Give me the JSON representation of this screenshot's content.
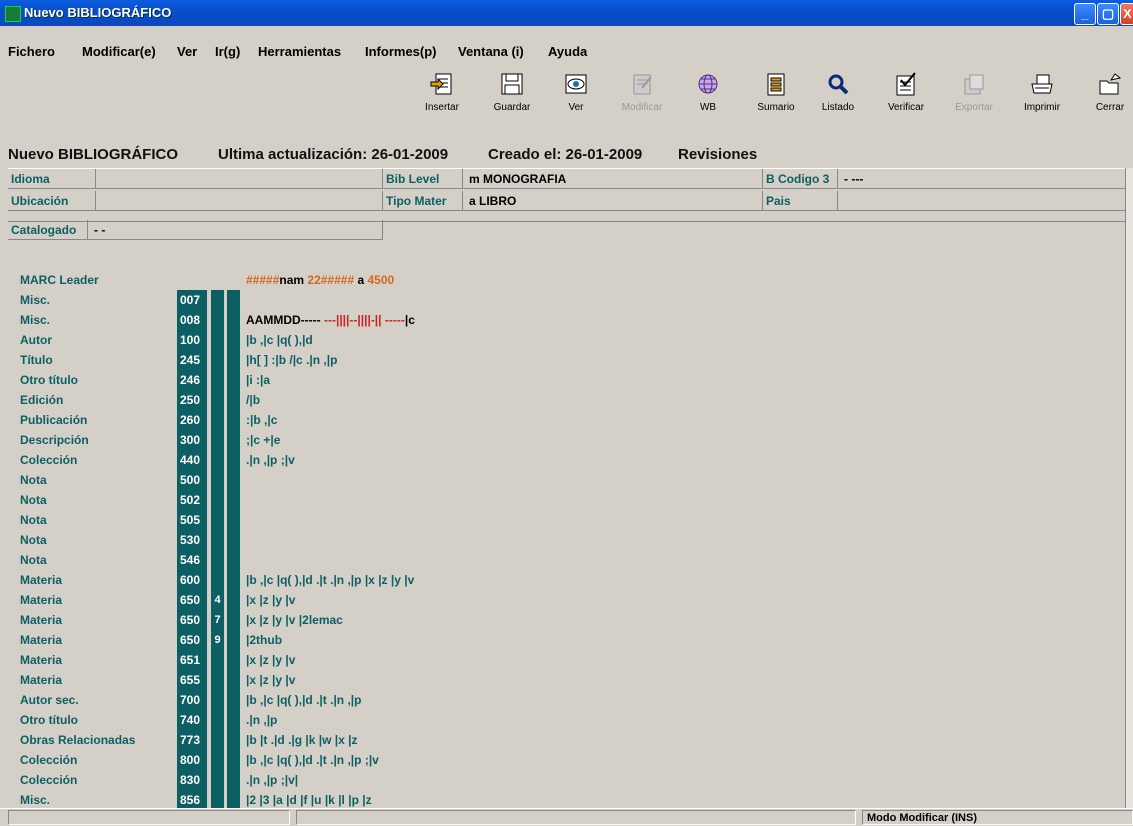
{
  "window": {
    "title": "Nuevo BIBLIOGRÁFICO",
    "min": "_",
    "max": "▢",
    "close": "X"
  },
  "menu": [
    {
      "label": "Fichero",
      "ul": "F"
    },
    {
      "label": "Modificar(e)"
    },
    {
      "label": "Ver"
    },
    {
      "label": "Ir(g)"
    },
    {
      "label": "Herramientas"
    },
    {
      "label": "Informes(p)"
    },
    {
      "label": "Ventana (i)"
    },
    {
      "label": "Ayuda"
    }
  ],
  "toolbar": [
    {
      "label": "Insertar",
      "icon": "insert-icon",
      "enabled": true
    },
    {
      "label": "Guardar",
      "icon": "save-icon",
      "enabled": true
    },
    {
      "label": "Ver",
      "icon": "view-icon",
      "enabled": true
    },
    {
      "label": "Modificar",
      "icon": "modify-icon",
      "enabled": false
    },
    {
      "label": "WB",
      "icon": "globe-icon",
      "enabled": true
    },
    {
      "label": "Sumario",
      "icon": "summary-icon",
      "enabled": true
    },
    {
      "label": "Listado",
      "icon": "search-icon",
      "enabled": true
    },
    {
      "label": "Verificar",
      "icon": "verify-icon",
      "enabled": true
    },
    {
      "label": "Exportar",
      "icon": "export-icon",
      "enabled": false
    },
    {
      "label": "Imprimir",
      "icon": "print-icon",
      "enabled": true
    },
    {
      "label": "Cerrar",
      "icon": "close-folder-icon",
      "enabled": true
    }
  ],
  "header": {
    "title": "Nuevo BIBLIOGRÁFICO",
    "updated": "Ultima actualización: 26-01-2009",
    "created": "Creado el: 26-01-2009",
    "revisions": "Revisiones"
  },
  "fields": {
    "idioma_label": "Idioma",
    "idioma_value": "",
    "bib_level_label": "Bib Level",
    "bib_level_value": "m  MONOGRAFIA",
    "bcodigo_label": "B Codigo 3",
    "bcodigo_value": "-  ---",
    "ubicacion_label": "Ubicación",
    "ubicacion_value": "",
    "tipo_label": "Tipo Mater",
    "tipo_value": "a  LIBRO",
    "pais_label": "Pais",
    "pais_value": "",
    "catalogado_label": "Catalogado",
    "catalogado_value": "-  -"
  },
  "leader": {
    "label": "MARC Leader",
    "part1": "#####",
    "part2": "nam",
    "part3": " 22#####",
    "part4": " a ",
    "part5": "4500"
  },
  "misc008": {
    "a": "AAMMDD-----",
    "b": "  ---||||--||||-||  -----",
    "c": "|c"
  },
  "records": [
    {
      "label": "Misc.",
      "tag": "007",
      "ind1": "",
      "ind2": "",
      "text": ""
    },
    {
      "label": "Misc.",
      "tag": "008",
      "ind1": "",
      "ind2": "",
      "text": ""
    },
    {
      "label": "Autor",
      "tag": "100",
      "ind1": "",
      "ind2": "",
      "text": "|b ,|c |q( ),|d"
    },
    {
      "label": "Título",
      "tag": "245",
      "ind1": "",
      "ind2": "",
      "text": " |h[ ] :|b /|c .|n ,|p"
    },
    {
      "label": "Otro título",
      "tag": "246",
      "ind1": "",
      "ind2": "",
      "text": "|i :|a"
    },
    {
      "label": "Edición",
      "tag": "250",
      "ind1": "",
      "ind2": "",
      "text": "/|b"
    },
    {
      "label": "Publicación",
      "tag": "260",
      "ind1": "",
      "ind2": "",
      "text": ":|b ,|c"
    },
    {
      "label": "Descripción",
      "tag": "300",
      "ind1": "",
      "ind2": "",
      "text": ";|c +|e"
    },
    {
      "label": "Colección",
      "tag": "440",
      "ind1": "",
      "ind2": "",
      "text": ".|n ,|p ;|v"
    },
    {
      "label": "Nota",
      "tag": "500",
      "ind1": "",
      "ind2": "",
      "text": ""
    },
    {
      "label": "Nota",
      "tag": "502",
      "ind1": "",
      "ind2": "",
      "text": ""
    },
    {
      "label": "Nota",
      "tag": "505",
      "ind1": "",
      "ind2": "",
      "text": ""
    },
    {
      "label": "Nota",
      "tag": "530",
      "ind1": "",
      "ind2": "",
      "text": ""
    },
    {
      "label": "Nota",
      "tag": "546",
      "ind1": "",
      "ind2": "",
      "text": ""
    },
    {
      "label": "Materia",
      "tag": "600",
      "ind1": "",
      "ind2": "",
      "text": "|b ,|c |q( ),|d .|t .|n ,|p |x |z |y |v"
    },
    {
      "label": "Materia",
      "tag": "650",
      "ind1": "",
      "ind2": "4",
      "text": "|x |z |y |v"
    },
    {
      "label": "Materia",
      "tag": "650",
      "ind1": "",
      "ind2": "7",
      "text": "|x |z |y |v |2lemac"
    },
    {
      "label": "Materia",
      "tag": "650",
      "ind1": "",
      "ind2": "9",
      "text": "|2thub"
    },
    {
      "label": "Materia",
      "tag": "651",
      "ind1": "",
      "ind2": "",
      "text": "|x |z |y |v"
    },
    {
      "label": "Materia",
      "tag": "655",
      "ind1": "",
      "ind2": "",
      "text": "|x |z |y |v"
    },
    {
      "label": "Autor sec.",
      "tag": "700",
      "ind1": "",
      "ind2": "",
      "text": "|b ,|c |q( ),|d .|t .|n ,|p"
    },
    {
      "label": "Otro título",
      "tag": "740",
      "ind1": "",
      "ind2": "",
      "text": ".|n ,|p"
    },
    {
      "label": "Obras Relacionadas",
      "tag": "773",
      "ind1": "",
      "ind2": "",
      "text": "|b |t .|d .|g |k |w |x |z"
    },
    {
      "label": "Colección",
      "tag": "800",
      "ind1": "",
      "ind2": "",
      "text": "|b ,|c |q( ),|d .|t .|n ,|p ;|v"
    },
    {
      "label": "Colección",
      "tag": "830",
      "ind1": "",
      "ind2": "",
      "text": " .|n ,|p ;|v|"
    },
    {
      "label": "Misc.",
      "tag": "856",
      "ind1": "",
      "ind2": "",
      "text": "|2 |3 |a |d |f |u |k |l |p |z"
    }
  ],
  "status": {
    "mode": "Modo Modificar (INS)"
  }
}
